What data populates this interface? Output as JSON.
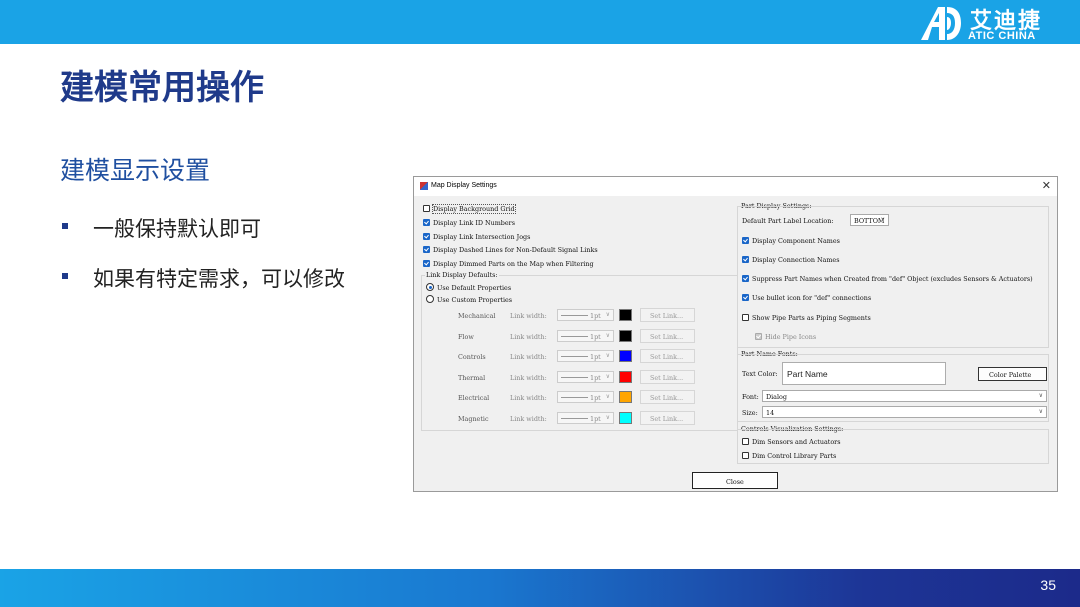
{
  "header": {
    "logo_cn": "艾迪捷",
    "logo_en": "ATIC CHINA"
  },
  "title": "建模常用操作",
  "subtitle": "建模显示设置",
  "bullets": [
    "一般保持默认即可",
    "如果有特定需求，可以修改"
  ],
  "page_number": "35",
  "colors": {
    "brand_blue": "#1aa3e6",
    "title_navy": "#1f3a8a",
    "checkbox_blue": "#1a66c8"
  },
  "dialog": {
    "title": "Map Display Settings",
    "close_icon": "close-icon",
    "left_checks": [
      {
        "label": "Display Background Grid",
        "checked": false
      },
      {
        "label": "Display Link ID Numbers",
        "checked": true
      },
      {
        "label": "Display Link Intersection Jogs",
        "checked": true
      },
      {
        "label": "Display Dashed Lines for Non-Default Signal Links",
        "checked": true
      },
      {
        "label": "Display Dimmed Parts on the Map when Filtering",
        "checked": true
      }
    ],
    "link_defaults": {
      "label": "Link Display Defaults:",
      "use_default": "Use Default Properties",
      "use_custom": "Use Custom Properties",
      "selected": "Use Default Properties",
      "width_label": "Link width:",
      "set_label": "Set Link...",
      "rows": [
        {
          "name": "Mechanical",
          "width": "1pt",
          "color": "#000000"
        },
        {
          "name": "Flow",
          "width": "1pt",
          "color": "#000000"
        },
        {
          "name": "Controls",
          "width": "1pt",
          "color": "#0000ff"
        },
        {
          "name": "Thermal",
          "width": "1pt",
          "color": "#ff0000"
        },
        {
          "name": "Electrical",
          "width": "1pt",
          "color": "#ffa500"
        },
        {
          "name": "Magnetic",
          "width": "1pt",
          "color": "#00ffff"
        }
      ]
    },
    "part_display": {
      "label": "Part Display Settings:",
      "location_label": "Default Part Label Location:",
      "location_value": "BOTTOM",
      "checks": [
        {
          "label": "Display Component Names",
          "checked": true
        },
        {
          "label": "Display Connection Names",
          "checked": true
        },
        {
          "label": "Suppress Part Names when Created from \"def\" Object (excludes Sensors & Actuators)",
          "checked": true
        },
        {
          "label": "Use bullet icon for \"def\" connections",
          "checked": true
        },
        {
          "label": "Show Pipe Parts as Piping Segments",
          "checked": false
        }
      ],
      "hide_pipe_icons": "Hide Pipe Icons"
    },
    "part_name_fonts": {
      "label": "Part Name Fonts:",
      "text_color_label": "Text Color:",
      "preview": "Part Name",
      "palette_button": "Color Palette",
      "font_label": "Font:",
      "font_value": "Dialog",
      "size_label": "Size:",
      "size_value": "14"
    },
    "controls_viz": {
      "label": "Controls Visualization Settings:",
      "checks": [
        {
          "label": "Dim Sensors and Actuators",
          "checked": false
        },
        {
          "label": "Dim Control Library Parts",
          "checked": false
        }
      ]
    },
    "close_button": "Close"
  }
}
